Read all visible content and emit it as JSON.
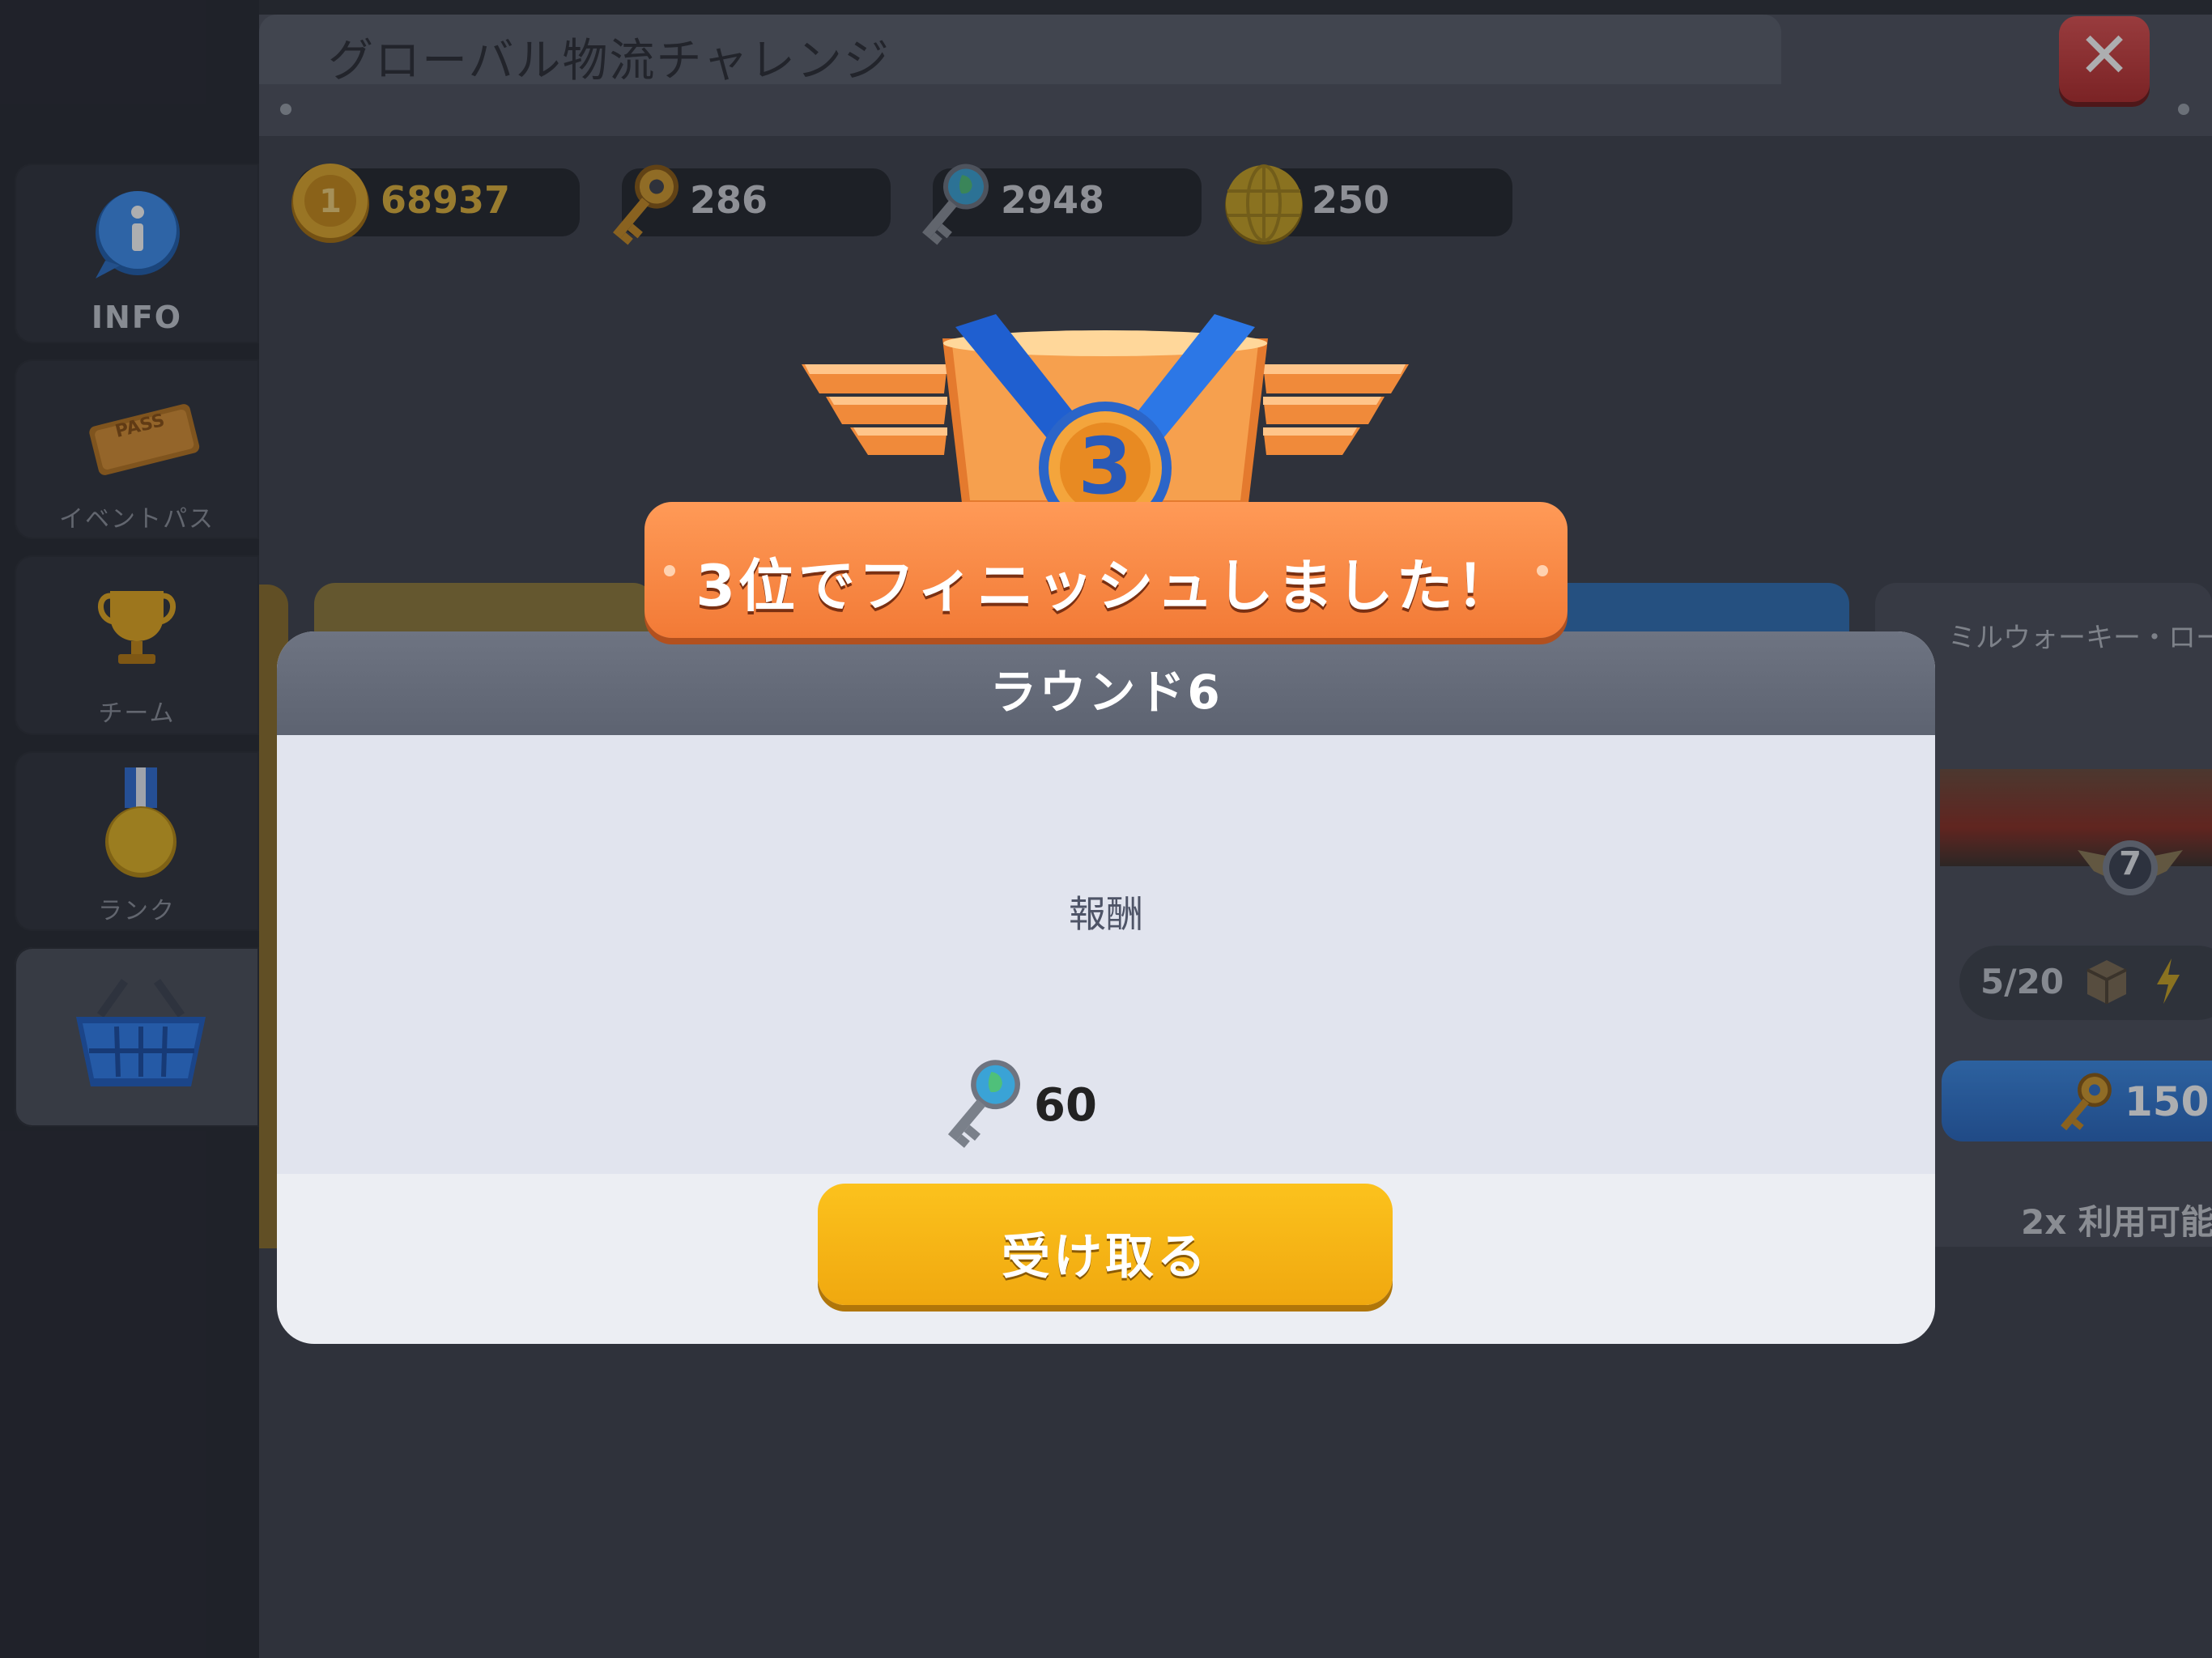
{
  "window": {
    "title": "グローバル物流チャレンジ",
    "close_label": "✕"
  },
  "sidebar": {
    "items": [
      {
        "label": "INFO",
        "icon": "info-icon"
      },
      {
        "label": "イベントパス",
        "icon": "event-pass-icon",
        "ticket_text": "PASS"
      },
      {
        "label": "チーム",
        "icon": "trophy-icon"
      },
      {
        "label": "ランク",
        "icon": "medal-icon"
      },
      {
        "label": "",
        "icon": "shop-basket-icon"
      }
    ]
  },
  "currencies": [
    {
      "value": "68937",
      "icon": "gold-coin-icon",
      "color": "#e0b23a"
    },
    {
      "value": "286",
      "icon": "gold-key-icon",
      "color": "#cfd2d8"
    },
    {
      "value": "2948",
      "icon": "globe-key-icon",
      "color": "#cfd2d8"
    },
    {
      "value": "250",
      "icon": "gold-globe-icon",
      "color": "#cfd2d8"
    }
  ],
  "background_cards": {
    "right_card": {
      "title": "ミルウォーキー・ロー",
      "level": "7",
      "progress": "5/20",
      "price": "150",
      "availability": "2x 利用可能"
    }
  },
  "banner": {
    "place_badge": "3",
    "text": "3位でフィニッシュしました！"
  },
  "modal": {
    "round": "ラウンド6",
    "reward_label": "報酬",
    "reward_amount": "60",
    "reward_icon": "globe-key-icon",
    "claim_button": "受け取る"
  },
  "colors": {
    "accent_orange": "#f27a36",
    "button_yellow": "#f0a80f",
    "close_red": "#d33a3a"
  }
}
